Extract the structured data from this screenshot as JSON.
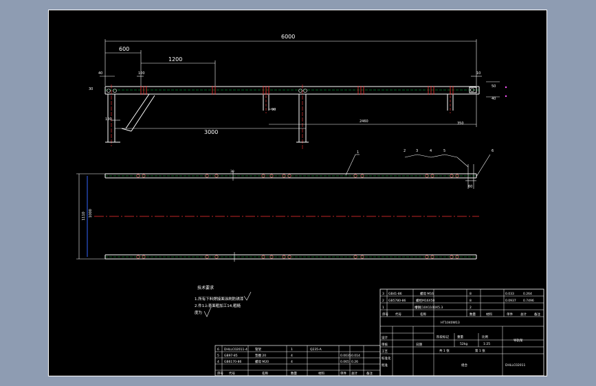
{
  "drawing": {
    "dimensions": {
      "overall_length": "6000",
      "d_600": "600",
      "d_1200": "1200",
      "d_40": "40",
      "d_100a": "100",
      "d_30": "30",
      "d_10": "10",
      "d_50r": "50",
      "d_40r": "40",
      "d_90": "90",
      "d_100b": "100",
      "d_3000": "3000",
      "d_2460": "2460",
      "d_350": "350",
      "d_1110": "1110",
      "d_1000": "1000",
      "d_30p": "30",
      "d_60": "60"
    },
    "balloons": [
      "1",
      "2",
      "3",
      "4",
      "5",
      "6"
    ]
  },
  "notes": {
    "title": "技术要求",
    "line1": "1.所有下料焊接面涂刷防锈漆",
    "line2": "2.件1上表面粗加工14,粗糙",
    "line3": "度为"
  },
  "parts_list": {
    "rows": [
      [
        "6",
        "DHLLC02011-4",
        "管架",
        "1",
        "Q235-A",
        "",
        ""
      ],
      [
        "5",
        "GB97-85",
        "垫圈 20",
        "4",
        "",
        "0.0035",
        "0.014"
      ],
      [
        "4",
        "GB6170-86",
        "螺母 M20",
        "4",
        "",
        "0.065",
        "0.26"
      ]
    ],
    "header": [
      "序号",
      "代号",
      "名称",
      "数量",
      "材料",
      "单件",
      "总计",
      "备注"
    ]
  },
  "title_block": {
    "upper_rows": [
      [
        "3",
        "GB41-86",
        "螺母 M16",
        "8",
        "",
        "0.033",
        "0.264"
      ],
      [
        "2",
        "GB5780-86",
        "螺栓M16X50",
        "8",
        "",
        "0.0937",
        "0.7496"
      ],
      [
        "1",
        "",
        "槽钢[10X1100X5.3",
        "2",
        "",
        "",
        ""
      ]
    ],
    "header": [
      "序号",
      "代号",
      "名称",
      "数量",
      "材料",
      "单件",
      "总计",
      "备注"
    ],
    "project": "HT1040W13",
    "fields": {
      "design": "设计",
      "check": "审核",
      "process": "工艺",
      "standard": "标准化",
      "approve": "批准",
      "date": "日期"
    },
    "stage": "阶段标记",
    "weight": "重量",
    "scale": "比例",
    "weight_val": "52kg",
    "scale_val": "1:25",
    "sheets": "共 1 张",
    "sheet_no": "第 1 张",
    "drawing_name": "导轨架",
    "drawing_no": "DHLLC02011",
    "company": "组合"
  }
}
